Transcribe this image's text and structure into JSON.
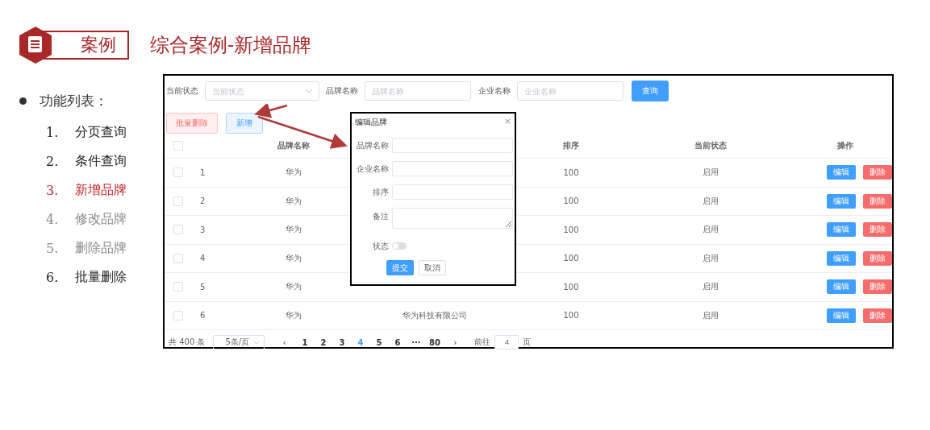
{
  "slide": {
    "badge": "案例",
    "title": "综合案例-新增品牌"
  },
  "feature_list": {
    "heading": "功能列表：",
    "items": [
      {
        "number": "1.",
        "label": "分页查询",
        "color": "#222222"
      },
      {
        "number": "2.",
        "label": "条件查询",
        "color": "#222222"
      },
      {
        "number": "3.",
        "label": "新增品牌",
        "color": "#c0282d"
      },
      {
        "number": "4.",
        "label": "修改品牌",
        "color": "#8c8c8c"
      },
      {
        "number": "5.",
        "label": "删除品牌",
        "color": "#8c8c8c"
      },
      {
        "number": "6.",
        "label": "批量删除",
        "color": "#222222"
      }
    ]
  },
  "search_form": {
    "fields": [
      {
        "label": "当前状态",
        "placeholder": "当前状态",
        "kind": "select"
      },
      {
        "label": "品牌名称",
        "placeholder": "品牌名称",
        "kind": "input"
      },
      {
        "label": "企业名称",
        "placeholder": "企业名称",
        "kind": "input"
      }
    ],
    "submit": "查询"
  },
  "toolbar": {
    "batch_delete": "批量删除",
    "add": "新增"
  },
  "table": {
    "header_checked": false,
    "columns": [
      "品牌名称",
      "排序",
      "当前状态",
      "操作"
    ],
    "rows": [
      {
        "id": "1",
        "brand": "华为",
        "order": "100",
        "status": "启用",
        "checked": false,
        "edit": "编辑",
        "delete": "删除"
      },
      {
        "id": "2",
        "brand": "华为",
        "order": "100",
        "status": "启用",
        "checked": false,
        "edit": "编辑",
        "delete": "删除"
      },
      {
        "id": "3",
        "brand": "华为",
        "order": "100",
        "status": "启用",
        "checked": false,
        "edit": "编辑",
        "delete": "删除"
      },
      {
        "id": "4",
        "brand": "华为",
        "order": "100",
        "status": "启用",
        "checked": false,
        "edit": "编辑",
        "delete": "删除"
      },
      {
        "id": "5",
        "brand": "华为",
        "order": "100",
        "status": "启用",
        "checked": false,
        "edit": "编辑",
        "delete": "删除"
      },
      {
        "id": "6",
        "brand": "华为",
        "company": "华为科技有限公司",
        "order": "100",
        "status": "启用",
        "checked": false,
        "edit": "编辑",
        "delete": "删除"
      }
    ]
  },
  "pagination": {
    "total": "共 400 条",
    "page_size": "5条/页",
    "prev": "‹",
    "next": "›",
    "pages": [
      {
        "label": "1",
        "selected": false
      },
      {
        "label": "2",
        "selected": false
      },
      {
        "label": "3",
        "selected": false
      },
      {
        "label": "4",
        "selected": true
      },
      {
        "label": "5",
        "selected": false
      },
      {
        "label": "6",
        "selected": false
      },
      {
        "label": "···",
        "selected": false
      },
      {
        "label": "80",
        "selected": false
      }
    ],
    "goto_label": "前往",
    "goto_value": "4",
    "page_unit": "页"
  },
  "dialog": {
    "title": "编辑品牌",
    "close": "×",
    "fields": [
      {
        "label": "品牌名称",
        "kind": "input"
      },
      {
        "label": "企业名称",
        "kind": "input"
      },
      {
        "label": "排序",
        "kind": "input"
      },
      {
        "label": "备注",
        "kind": "textarea"
      },
      {
        "label": "状态",
        "kind": "switch",
        "on": false
      }
    ],
    "submit": "提交",
    "cancel": "取消"
  }
}
